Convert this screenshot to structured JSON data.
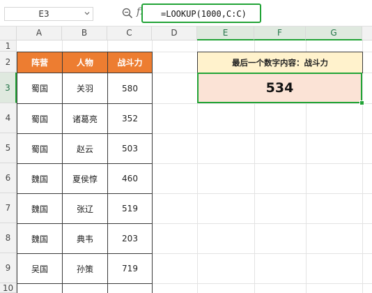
{
  "formula_bar": {
    "name_box": "E3",
    "fx_label": "fx",
    "formula": "=LOOKUP(1000,C:C)"
  },
  "columns": [
    "A",
    "B",
    "C",
    "D",
    "E",
    "F",
    "G"
  ],
  "rows": [
    "1",
    "2",
    "3",
    "4",
    "5",
    "6",
    "7",
    "8",
    "9",
    "10"
  ],
  "table": {
    "headers": [
      "阵营",
      "人物",
      "战斗力"
    ],
    "rows": [
      [
        "蜀国",
        "关羽",
        "580"
      ],
      [
        "蜀国",
        "诸葛亮",
        "352"
      ],
      [
        "蜀国",
        "赵云",
        "503"
      ],
      [
        "魏国",
        "夏侯惇",
        "460"
      ],
      [
        "魏国",
        "张辽",
        "519"
      ],
      [
        "魏国",
        "典韦",
        "203"
      ],
      [
        "吴国",
        "孙策",
        "719"
      ]
    ]
  },
  "result": {
    "title": "最后一个数字内容：战斗力",
    "value": "534"
  },
  "selected_cell": "E3",
  "colors": {
    "header_orange": "#ed7d31",
    "title_yellow": "#fff2cc",
    "result_peach": "#fbe3d6",
    "selection_green": "#21a336"
  },
  "icons": [
    "chevron-down-icon",
    "zoom-icon",
    "function-icon"
  ]
}
